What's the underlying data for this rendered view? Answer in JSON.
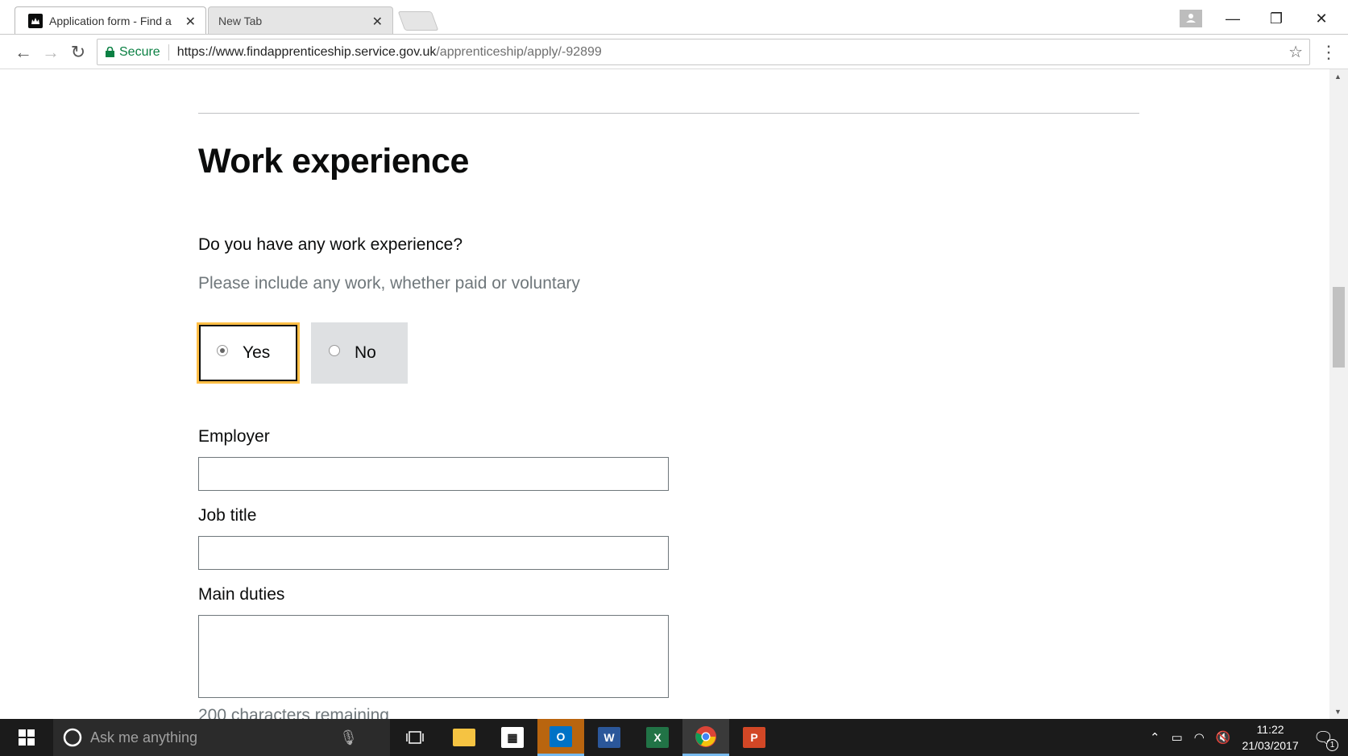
{
  "browser": {
    "tabs": [
      {
        "title": "Application form - Find a",
        "active": true
      },
      {
        "title": "New Tab",
        "active": false
      }
    ],
    "secure_label": "Secure",
    "url_host": "https://www.findapprenticeship.service.gov.uk",
    "url_path": "/apprenticeship/apply/-92899"
  },
  "form": {
    "heading": "Work experience",
    "question": "Do you have any work experience?",
    "hint": "Please include any work, whether paid or voluntary",
    "options": [
      {
        "label": "Yes",
        "selected": true
      },
      {
        "label": "No",
        "selected": false
      }
    ],
    "employer_label": "Employer",
    "employer_value": "",
    "job_title_label": "Job title",
    "job_title_value": "",
    "main_duties_label": "Main duties",
    "main_duties_value": "",
    "counter_text": "200 characters remaining"
  },
  "taskbar": {
    "search_placeholder": "Ask me anything",
    "time": "11:22",
    "date": "21/03/2017",
    "notification_count": "1",
    "apps": [
      "task-view",
      "file-explorer",
      "store",
      "outlook",
      "word",
      "excel",
      "chrome",
      "powerpoint"
    ]
  },
  "colors": {
    "focus": "#ffbf47",
    "secure_green": "#0b8043",
    "taskbar": "#1b1b1b"
  }
}
